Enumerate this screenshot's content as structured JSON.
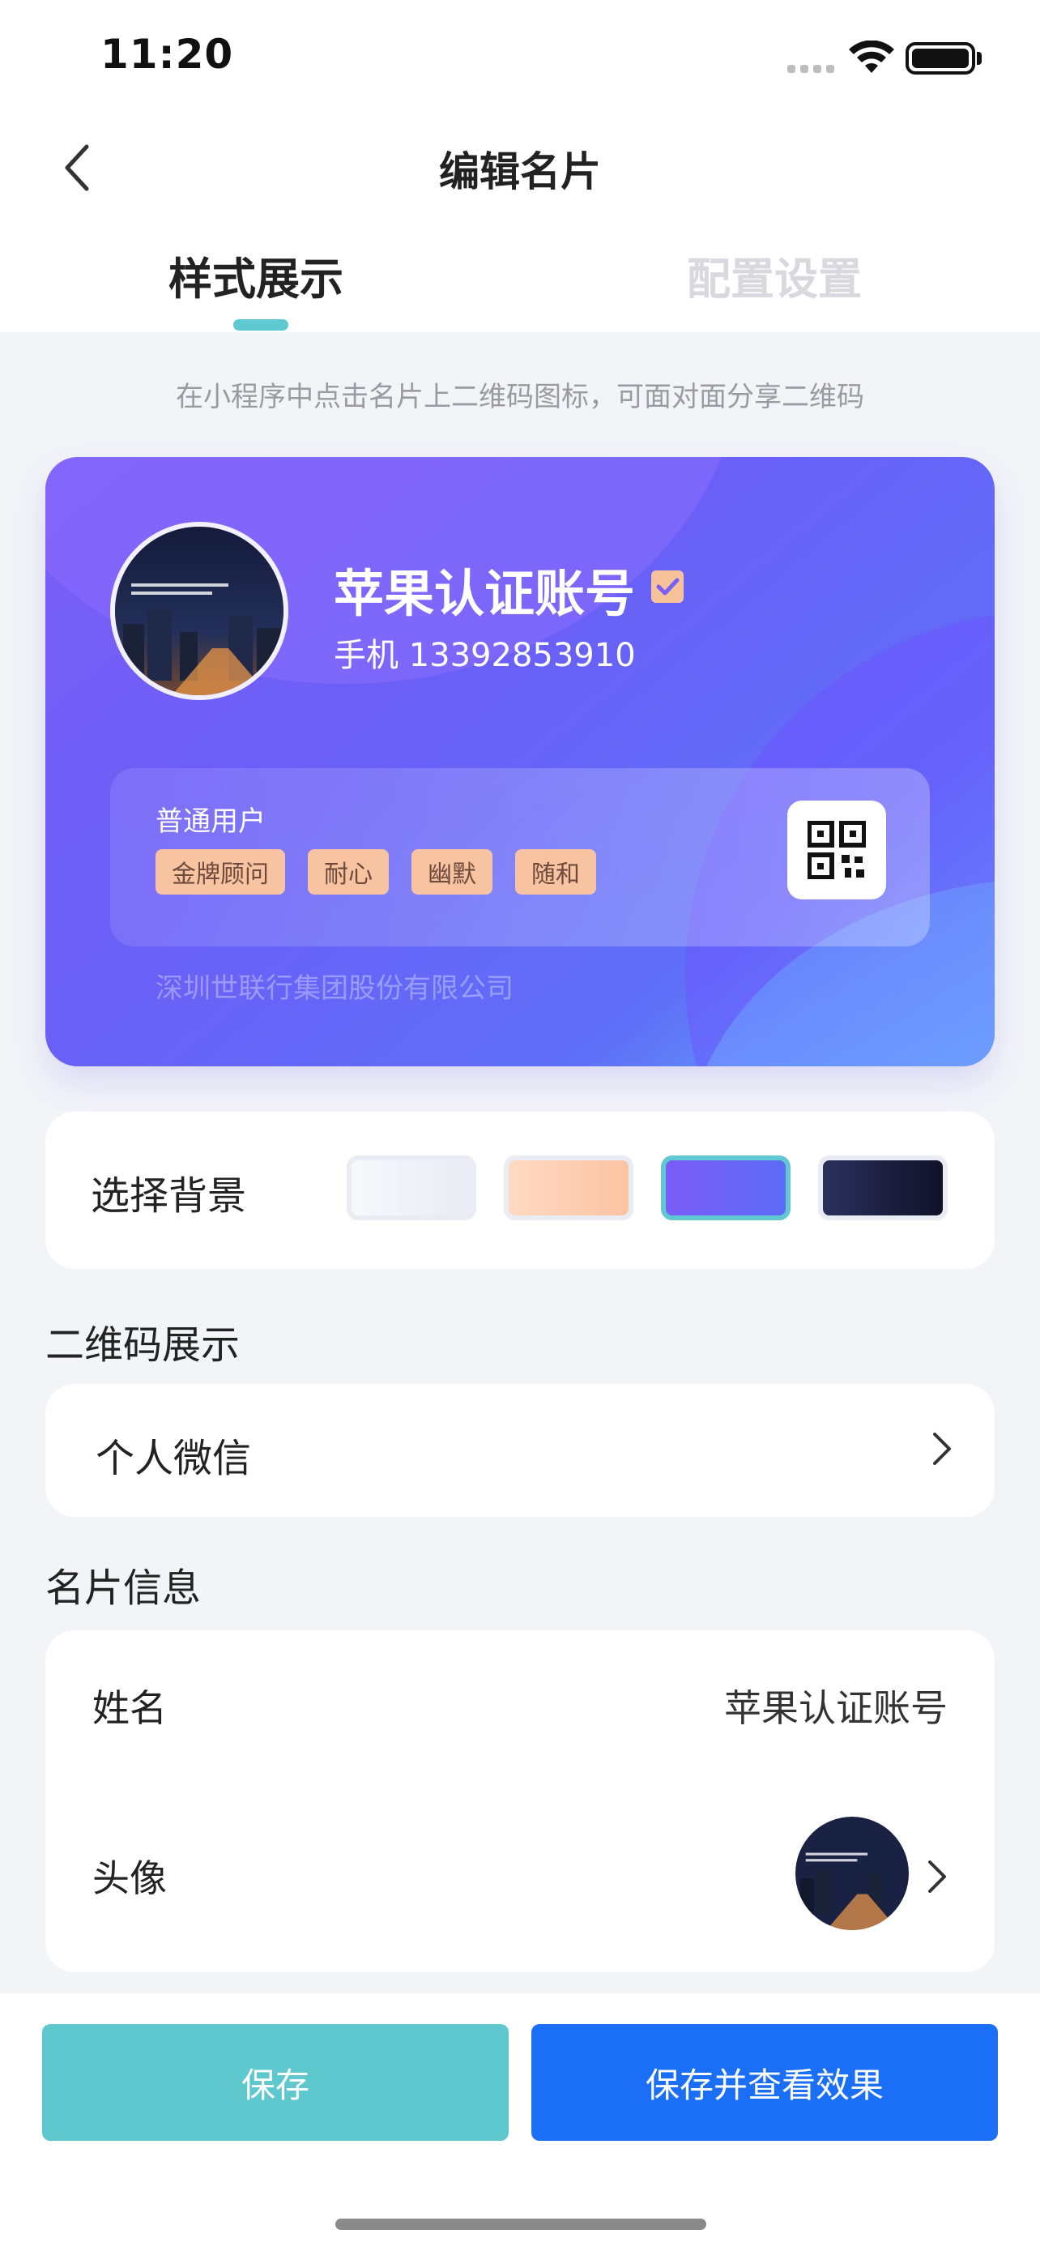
{
  "status_bar": {
    "time": "11:20"
  },
  "nav": {
    "title": "编辑名片",
    "back_icon": "chevron-left-icon"
  },
  "tabs": [
    {
      "label": "样式展示",
      "active": true
    },
    {
      "label": "配置设置",
      "active": false
    }
  ],
  "hint": "在小程序中点击名片上二维码图标，可面对面分享二维码",
  "card": {
    "name": "苹果认证账号",
    "phone": "手机 13392853910",
    "user_type": "普通用户",
    "tags": [
      "金牌顾问",
      "耐心",
      "幽默",
      "随和"
    ],
    "company": "深圳世联行集团股份有限公司"
  },
  "background": {
    "label": "选择背景",
    "options": [
      "light",
      "peach",
      "purple-blue",
      "dark-navy"
    ],
    "selected": "purple-blue"
  },
  "qr_section": {
    "title": "二维码展示",
    "value": "个人微信"
  },
  "info_section": {
    "title": "名片信息",
    "rows": [
      {
        "label": "姓名",
        "value": "苹果认证账号"
      },
      {
        "label": "头像"
      }
    ]
  },
  "buttons": {
    "save": "保存",
    "save_and_view": "保存并查看效果"
  },
  "colors": {
    "accent": "#5ec8ce",
    "primary": "#1a6ff6",
    "tag_bg": "#f8c3a1"
  }
}
